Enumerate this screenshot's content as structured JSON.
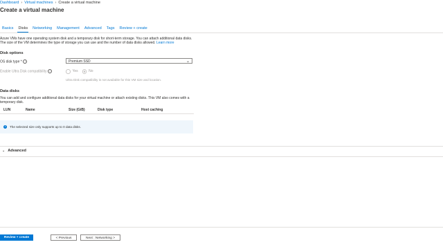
{
  "breadcrumb": {
    "items": [
      "Dashboard",
      "Virtual machines"
    ],
    "current": "Create a virtual machine"
  },
  "page_title": "Create a virtual machine",
  "tabs": [
    {
      "label": "Basics"
    },
    {
      "label": "Disks"
    },
    {
      "label": "Networking"
    },
    {
      "label": "Management"
    },
    {
      "label": "Advanced"
    },
    {
      "label": "Tags"
    },
    {
      "label": "Review + create"
    }
  ],
  "active_tab": "Disks",
  "intro": {
    "text": "Azure VMs have one operating system disk and a temporary disk for short-term storage. You can attach additional data disks. The size of the VM determines the type of storage you can use and the number of data disks allowed.",
    "link": "Learn more"
  },
  "disk_options": {
    "heading": "Disk options",
    "os_disk_label": "OS disk type *",
    "os_disk_value": "Premium SSD",
    "ultra_label": "Enable Ultra Disk compatibility",
    "radio_yes": "Yes",
    "radio_no": "No",
    "ultra_note": "Ultra Disk compatibility is not available for this VM size and location."
  },
  "data_disks": {
    "heading": "Data disks",
    "intro": "You can add and configure additional data disks for your virtual machine or attach existing disks. This VM also comes with a temporary disk.",
    "columns": [
      "LUN",
      "Name",
      "Size (GiB)",
      "Disk type",
      "Host caching"
    ],
    "info": "The selected size only supports up to 0 data disks."
  },
  "advanced_label": "Advanced",
  "footer": {
    "review_create": "Review + create",
    "previous": "< Previous",
    "next": "Next : Networking >"
  },
  "colors": {
    "accent": "#0078d4",
    "info_bg": "#eff6fc"
  }
}
